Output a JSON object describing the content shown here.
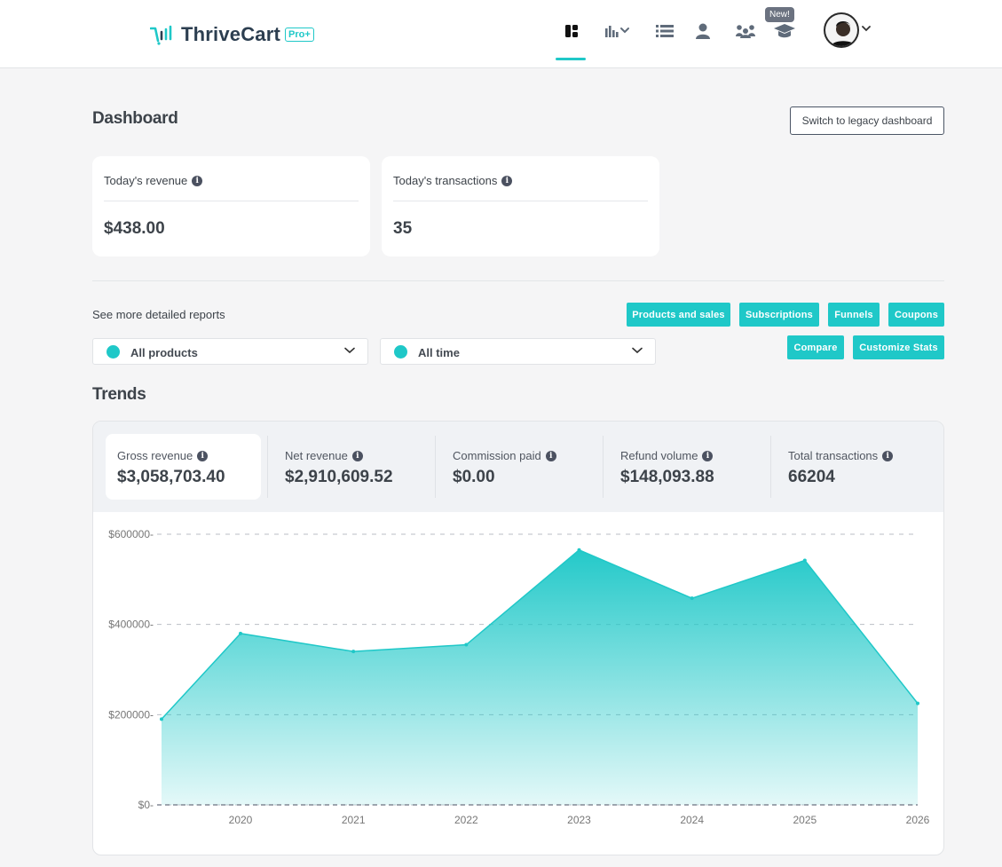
{
  "brand": {
    "name": "ThriveCart",
    "badge": "Pro+",
    "accent": "#1fc8c8"
  },
  "nav": {
    "items": [
      {
        "name": "dashboard-icon",
        "active": true
      },
      {
        "name": "reports-chart-icon",
        "active": false
      },
      {
        "name": "list-icon",
        "active": false
      },
      {
        "name": "user-icon",
        "active": false
      },
      {
        "name": "affiliates-icon",
        "active": false
      },
      {
        "name": "learn-cap-icon",
        "active": false
      }
    ],
    "new_badge": "New!"
  },
  "dashboard": {
    "title": "Dashboard",
    "legacy_button": "Switch to legacy dashboard",
    "cards": [
      {
        "label": "Today's revenue",
        "value": "$438.00"
      },
      {
        "label": "Today's transactions",
        "value": "35"
      }
    ]
  },
  "reports": {
    "see_more": "See more detailed reports",
    "buttons": [
      "Products and sales",
      "Subscriptions",
      "Funnels",
      "Coupons",
      "Compare",
      "Customize Stats"
    ],
    "product_filter": "All products",
    "time_filter": "All time"
  },
  "trends": {
    "title": "Trends",
    "metrics": [
      {
        "label": "Gross revenue",
        "value": "$3,058,703.40",
        "active": true
      },
      {
        "label": "Net revenue",
        "value": "$2,910,609.52",
        "active": false
      },
      {
        "label": "Commission paid",
        "value": "$0.00",
        "active": false
      },
      {
        "label": "Refund volume",
        "value": "$148,093.88",
        "active": false
      },
      {
        "label": "Total transactions",
        "value": "66204",
        "active": false
      }
    ]
  },
  "chart_data": {
    "type": "area",
    "x": [
      2019.3,
      2020,
      2021,
      2022,
      2023,
      2024,
      2025,
      2026
    ],
    "x_ticks": [
      "2020",
      "2021",
      "2022",
      "2023",
      "2024",
      "2025",
      "2026"
    ],
    "y_ticks": [
      "$0",
      "$200000",
      "$400000",
      "$600000"
    ],
    "ylim": [
      0,
      600000
    ],
    "series": [
      {
        "values": [
          190000,
          380000,
          340000,
          355000,
          565000,
          458000,
          542000,
          225000
        ]
      }
    ],
    "grid": true,
    "color": "#1fc8c8"
  }
}
